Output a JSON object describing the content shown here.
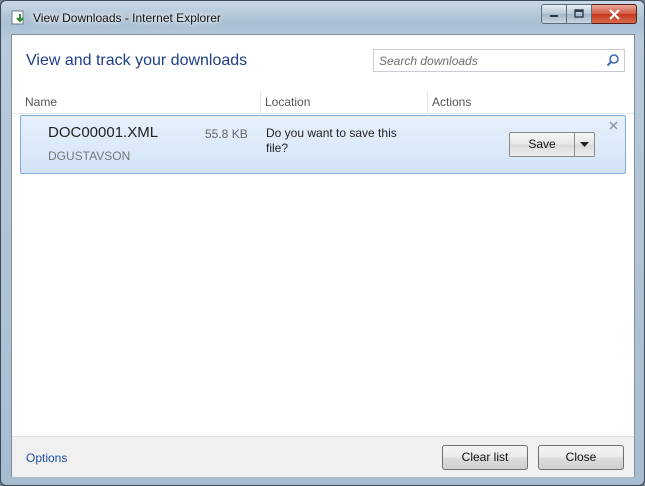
{
  "window": {
    "title": "View Downloads - Internet Explorer"
  },
  "header": {
    "title": "View and track your downloads",
    "search_placeholder": "Search downloads"
  },
  "columns": [
    "Name",
    "Location",
    "Actions"
  ],
  "downloads": [
    {
      "name": "DOC00001.XML",
      "size": "55.8 KB",
      "source": "DGUSTAVSON",
      "prompt": "Do you want to save this file?",
      "action": "Save"
    }
  ],
  "footer": {
    "options_label": "Options",
    "clear_label": "Clear list",
    "close_label": "Close"
  },
  "colors": {
    "accent_text": "#1e3f87",
    "link": "#1e50a2",
    "item_border": "#84acdd",
    "item_bg": "#dbe8f8"
  }
}
